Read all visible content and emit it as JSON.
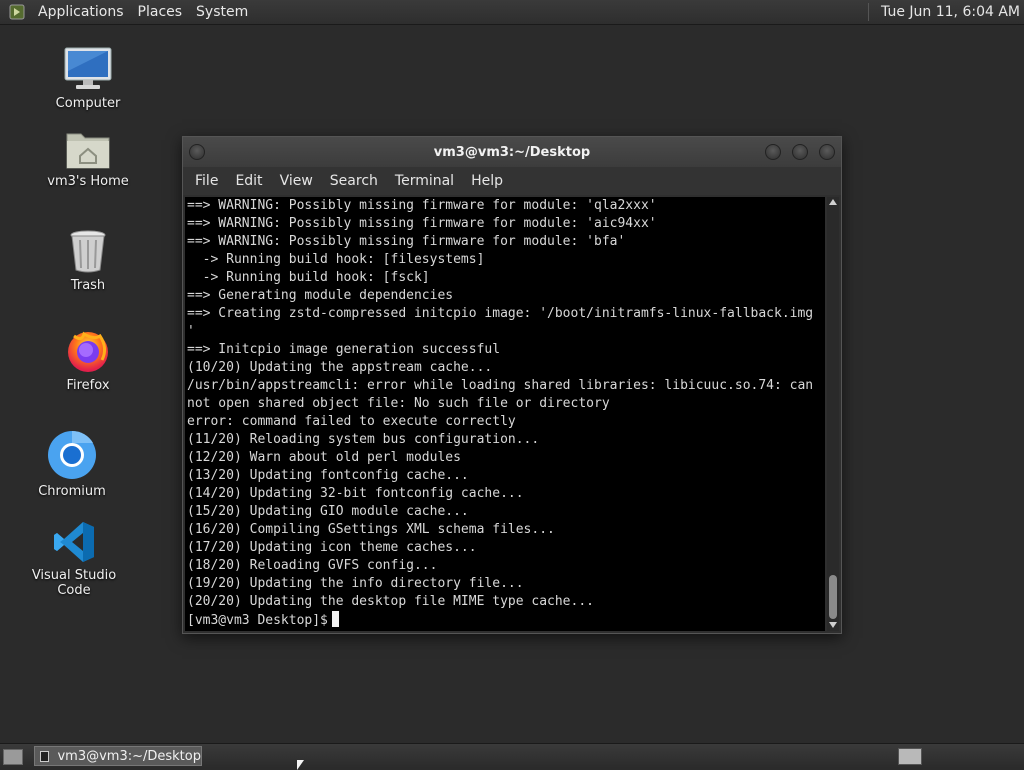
{
  "top_panel": {
    "menus": [
      "Applications",
      "Places",
      "System"
    ],
    "clock": "Tue Jun 11,  6:04 AM"
  },
  "desktop_icons": [
    {
      "label": "Computer",
      "icon": "computer-icon"
    },
    {
      "label": "vm3's Home",
      "icon": "home-folder-icon"
    },
    {
      "label": "Trash",
      "icon": "trash-icon"
    },
    {
      "label": "Firefox",
      "icon": "firefox-icon"
    },
    {
      "label": "Chromium",
      "icon": "chromium-icon"
    },
    {
      "label": "Visual Studio Code",
      "icon": "vscode-icon"
    }
  ],
  "terminal": {
    "title": "vm3@vm3:~/Desktop",
    "menus": [
      "File",
      "Edit",
      "View",
      "Search",
      "Terminal",
      "Help"
    ],
    "lines": [
      "==> WARNING: Possibly missing firmware for module: 'qla2xxx'",
      "==> WARNING: Possibly missing firmware for module: 'aic94xx'",
      "==> WARNING: Possibly missing firmware for module: 'bfa'",
      "  -> Running build hook: [filesystems]",
      "  -> Running build hook: [fsck]",
      "==> Generating module dependencies",
      "==> Creating zstd-compressed initcpio image: '/boot/initramfs-linux-fallback.img",
      "'",
      "==> Initcpio image generation successful",
      "(10/20) Updating the appstream cache...",
      "/usr/bin/appstreamcli: error while loading shared libraries: libicuuc.so.74: can",
      "not open shared object file: No such file or directory",
      "error: command failed to execute correctly",
      "(11/20) Reloading system bus configuration...",
      "(12/20) Warn about old perl modules",
      "(13/20) Updating fontconfig cache...",
      "(14/20) Updating 32-bit fontconfig cache...",
      "(15/20) Updating GIO module cache...",
      "(16/20) Compiling GSettings XML schema files...",
      "(17/20) Updating icon theme caches...",
      "(18/20) Reloading GVFS config...",
      "(19/20) Updating the info directory file...",
      "(20/20) Updating the desktop file MIME type cache..."
    ],
    "prompt": "[vm3@vm3 Desktop]$"
  },
  "taskbar": {
    "window_label": "vm3@vm3:~/Desktop"
  }
}
